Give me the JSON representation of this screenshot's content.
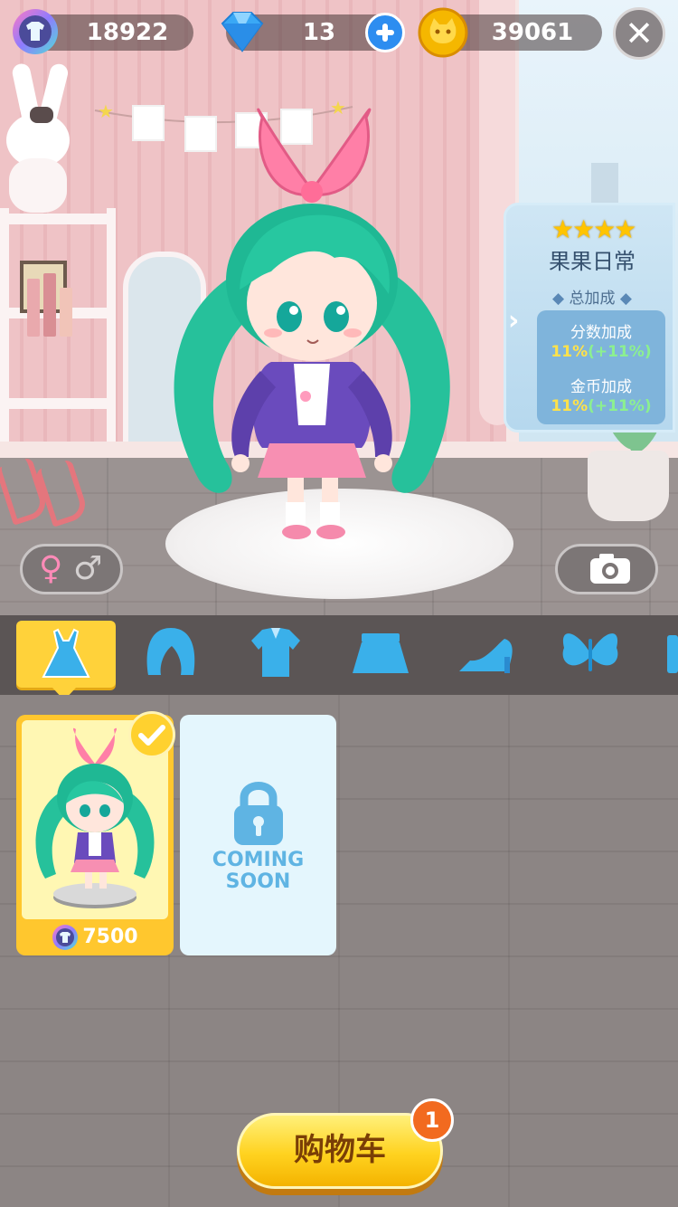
{
  "currency": {
    "tokens": {
      "icon": "shirt-token-icon",
      "value": "18922"
    },
    "diamonds": {
      "icon": "diamond-icon",
      "value": "13",
      "add_icon": "plus-icon"
    },
    "coins": {
      "icon": "cat-coin-icon",
      "value": "39061"
    },
    "close_icon": "close-icon",
    "close_label": "✕"
  },
  "bonus_panel": {
    "stars": 4,
    "stars_text": "★★★★",
    "title": "果果日常",
    "subtitle": "总加成",
    "score_label": "分数加成",
    "score_value": "11%",
    "score_extra": "(+11%)",
    "coin_label": "金币加成",
    "coin_value": "11%",
    "coin_extra": "(+11%)",
    "arrow": "›"
  },
  "buttons": {
    "gender_icon": "gender-switch-icon",
    "gender_female": "♀",
    "gender_male": "♂",
    "camera_icon": "camera-icon"
  },
  "categories": [
    {
      "name": "dress",
      "icon": "dress-icon",
      "active": true
    },
    {
      "name": "hair",
      "icon": "hair-icon",
      "active": false
    },
    {
      "name": "top",
      "icon": "shirt-icon",
      "active": false
    },
    {
      "name": "skirt",
      "icon": "skirt-icon",
      "active": false
    },
    {
      "name": "shoes",
      "icon": "shoe-icon",
      "active": false
    },
    {
      "name": "wings",
      "icon": "butterfly-icon",
      "active": false
    }
  ],
  "items": [
    {
      "owned": true,
      "selected": true,
      "price": "7500",
      "price_icon": "shirt-token-icon"
    },
    {
      "locked": true,
      "line1": "COMING",
      "line2": "SOON",
      "icon": "padlock-icon"
    }
  ],
  "cart": {
    "label": "购物车",
    "badge": "1"
  },
  "colors": {
    "accent_yellow": "#ffd23a",
    "panel_blue": "#b6d8ee",
    "coming_soon_blue": "#5fb4e3",
    "badge_orange": "#f26a1f"
  }
}
